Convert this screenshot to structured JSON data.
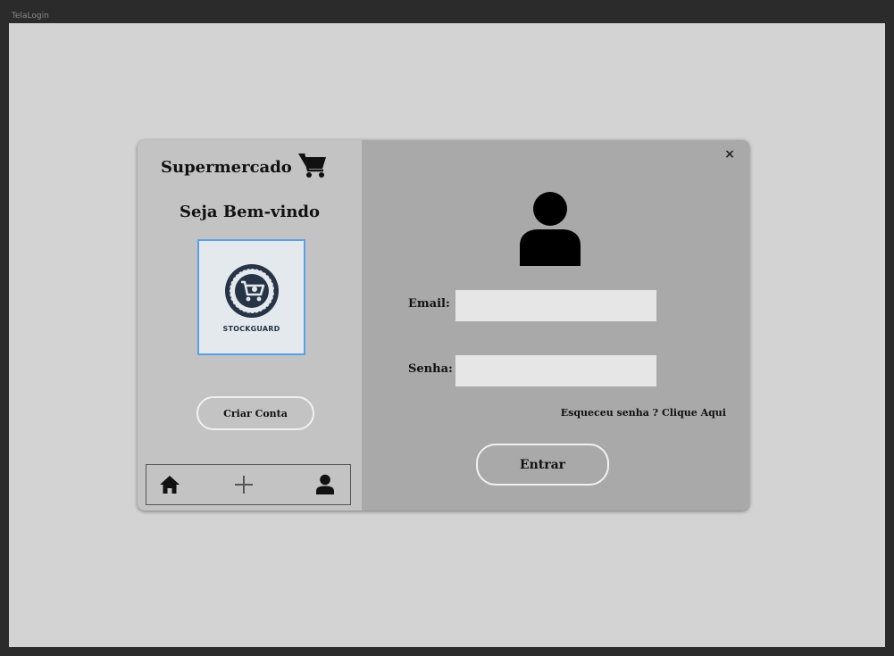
{
  "window": {
    "title": "TelaLogin"
  },
  "sidebar": {
    "brand_title": "Supermercado",
    "brand_icon": "shopping-cart-icon",
    "welcome_text": "Seja Bem-vindo",
    "logo_text": "STOCKGUARD",
    "create_account_label": "Criar Conta",
    "nav": [
      {
        "name": "home",
        "icon": "home-icon"
      },
      {
        "name": "add",
        "icon": "plus-icon"
      },
      {
        "name": "profile",
        "icon": "user-icon"
      }
    ]
  },
  "login": {
    "close_label": "×",
    "avatar_icon": "user-avatar-icon",
    "email_label": "Email:",
    "email_value": "",
    "password_label": "Senha:",
    "password_value": "",
    "forgot_text": "Esqueceu senha ? Clique Aqui",
    "submit_label": "Entrar"
  },
  "colors": {
    "window_bg": "#2b2b2b",
    "client_bg": "#d3d3d3",
    "left_pane": "#c3c3c3",
    "right_pane": "#a9a9a9",
    "logo_border": "#5aa0e8",
    "logo_navy": "#263446"
  }
}
